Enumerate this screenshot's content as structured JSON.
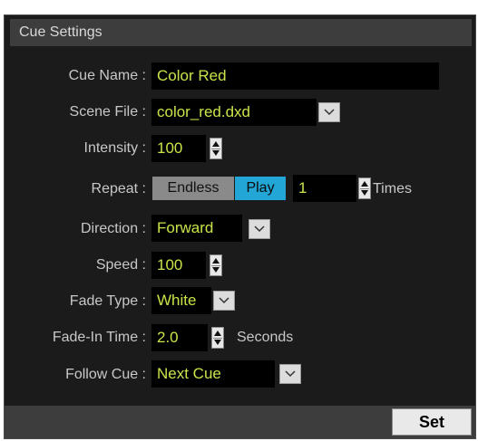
{
  "panel": {
    "title": "Cue Settings"
  },
  "fields": {
    "cue_name": {
      "label": "Cue Name :",
      "value": "Color Red"
    },
    "scene_file": {
      "label": "Scene File :",
      "value": "color_red.dxd"
    },
    "intensity": {
      "label": "Intensity :",
      "value": "100"
    },
    "repeat": {
      "label": "Repeat :",
      "endless_label": "Endless",
      "play_label": "Play",
      "value": "1",
      "suffix": "Times"
    },
    "direction": {
      "label": "Direction :",
      "value": "Forward"
    },
    "speed": {
      "label": "Speed :",
      "value": "100"
    },
    "fade_type": {
      "label": "Fade Type :",
      "value": "White"
    },
    "fade_in_time": {
      "label": "Fade-In Time :",
      "value": "2.0",
      "suffix": "Seconds"
    },
    "follow_cue": {
      "label": "Follow Cue :",
      "value": "Next Cue"
    }
  },
  "footer": {
    "set_label": "Set"
  },
  "colors": {
    "panel_bg": "#1b1b1b",
    "header_bg": "#3d3d3d",
    "value_text": "#c8e44a",
    "label_text": "#c8c8c8",
    "play_accent": "#21a6d6"
  },
  "icons": {
    "dropdown": "chevron-down-icon",
    "spinner": "spinner-arrows-icon"
  }
}
